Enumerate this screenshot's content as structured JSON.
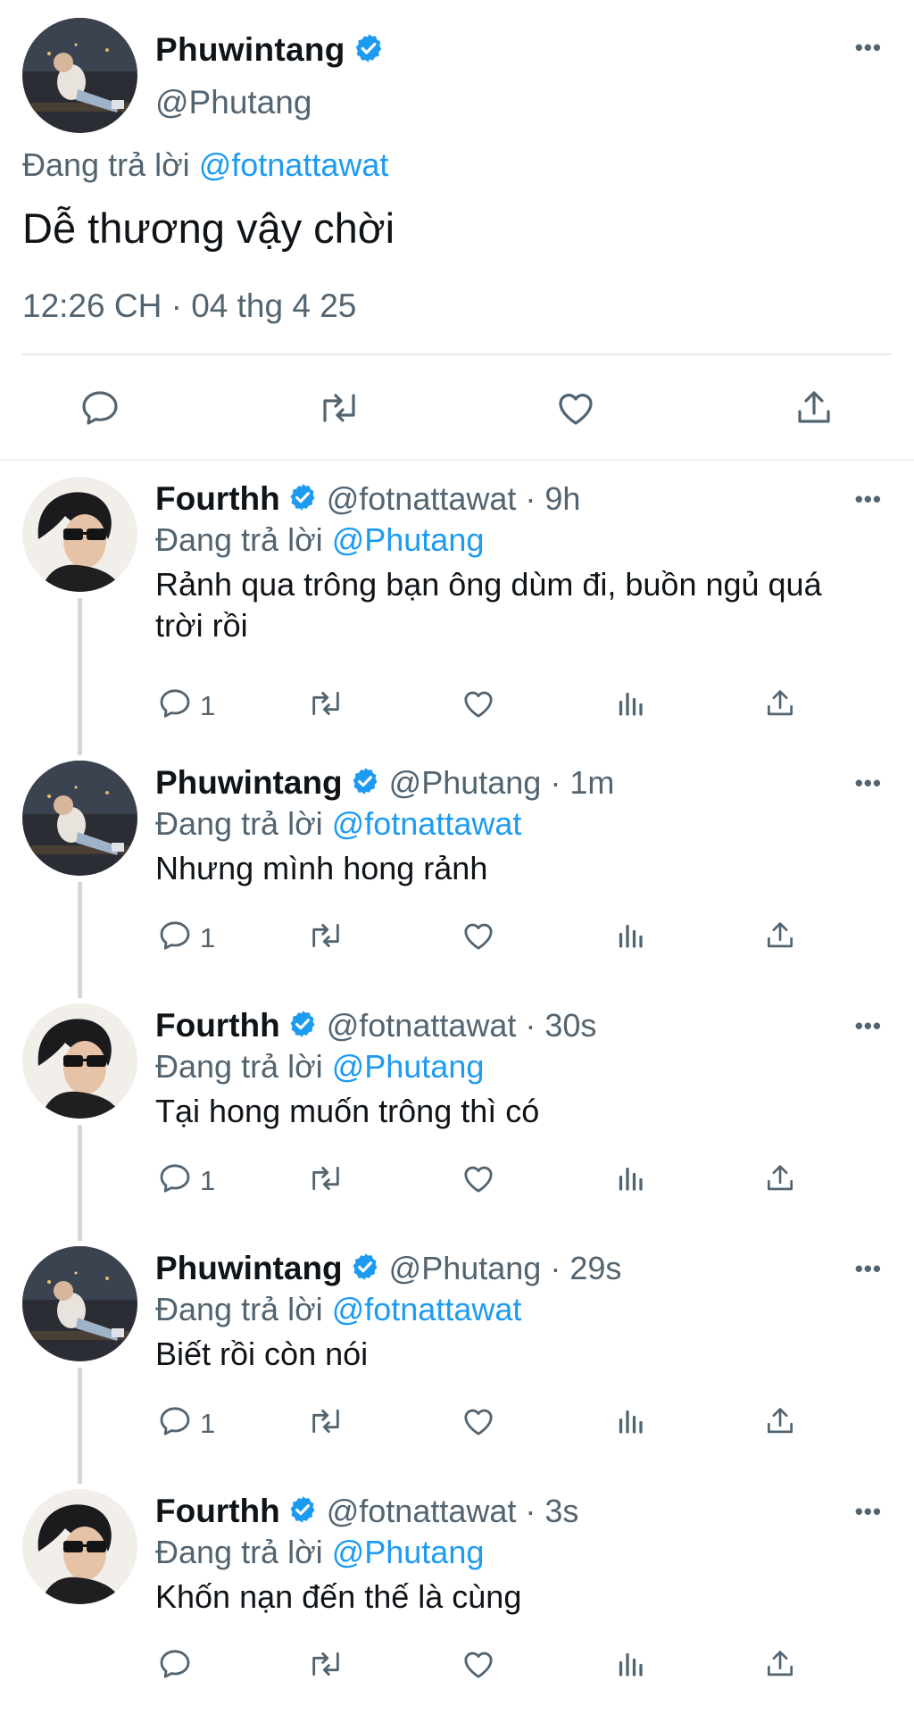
{
  "colors": {
    "accent": "#1d9bf0",
    "secondary_text": "#536471",
    "primary_text": "#0f1419",
    "thread_line": "#cfd9de"
  },
  "main_tweet": {
    "display_name": "Phuwintang",
    "handle": "@Phutang",
    "replying_prefix": "Đang trả lời",
    "replying_to": "@fotnattawat",
    "text": "Dễ thương vậy chời",
    "timestamp": "12:26 CH · 04 thg 4 25",
    "more_label": "•••",
    "actions": [
      "reply-icon",
      "retweet-icon",
      "like-icon",
      "share-icon"
    ]
  },
  "replies": [
    {
      "display_name": "Fourthh",
      "meta": "@fotnattawat · 9h",
      "replying_prefix": "Đang trả lời",
      "replying_to": "@Phutang",
      "text": "Rảnh qua trông bạn ông dùm đi, buồn ngủ quá trời rồi",
      "reply_count": "1",
      "more_label": "•••"
    },
    {
      "display_name": "Phuwintang",
      "meta": "@Phutang · 1m",
      "replying_prefix": "Đang trả lời",
      "replying_to": "@fotnattawat",
      "text": "Nhưng mình hong rảnh",
      "reply_count": "1",
      "more_label": "•••"
    },
    {
      "display_name": "Fourthh",
      "meta": "@fotnattawat · 30s",
      "replying_prefix": "Đang trả lời",
      "replying_to": "@Phutang",
      "text": "Tại hong muốn trông thì có",
      "reply_count": "1",
      "more_label": "•••"
    },
    {
      "display_name": "Phuwintang",
      "meta": "@Phutang · 29s",
      "replying_prefix": "Đang trả lời",
      "replying_to": "@fotnattawat",
      "text": "Biết rồi còn nói",
      "reply_count": "1",
      "more_label": "•••"
    },
    {
      "display_name": "Fourthh",
      "meta": "@fotnattawat · 3s",
      "replying_prefix": "Đang trả lời",
      "replying_to": "@Phutang",
      "text": "Khốn nạn đến thế là cùng",
      "reply_count": "",
      "more_label": "•••"
    }
  ]
}
